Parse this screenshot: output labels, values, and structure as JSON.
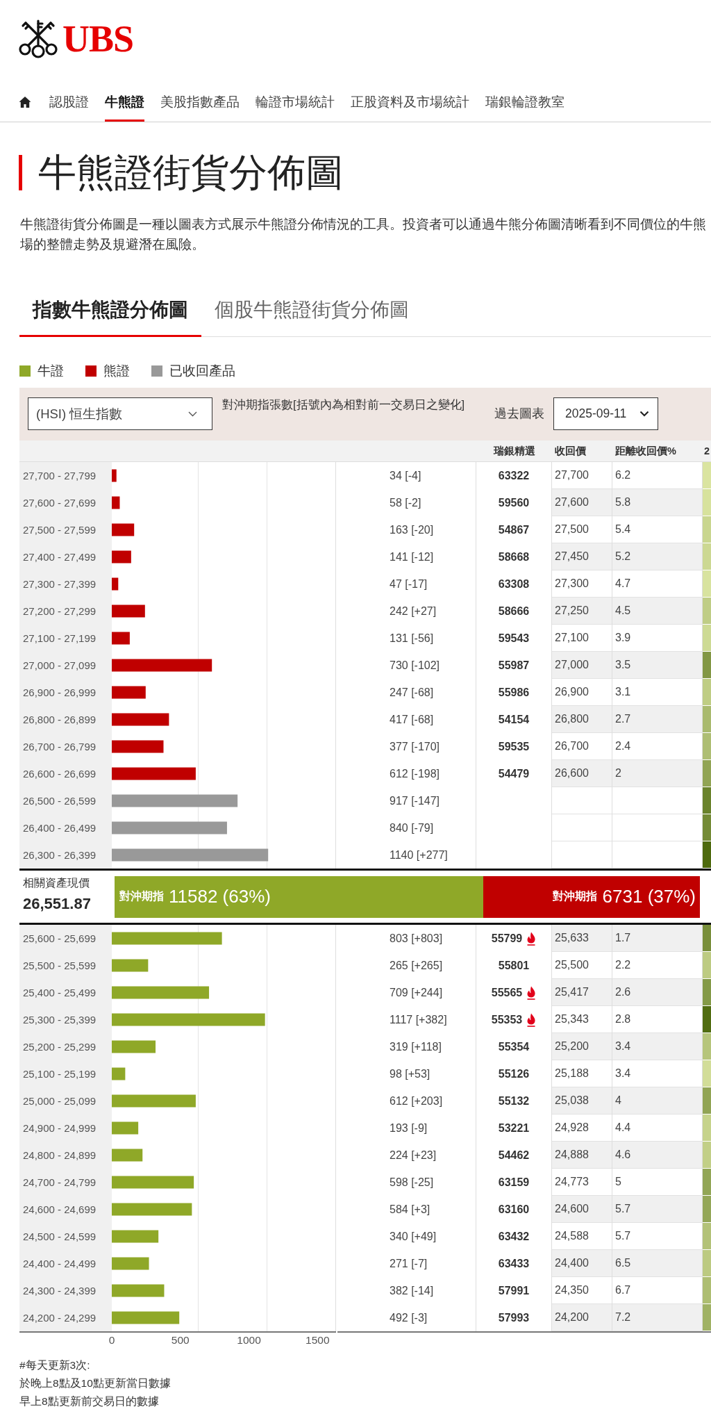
{
  "header": {
    "logo_text": "UBS"
  },
  "nav": [
    {
      "label": "認股證",
      "selected": false
    },
    {
      "label": "牛熊證",
      "selected": true
    },
    {
      "label": "美股指數產品",
      "selected": false
    },
    {
      "label": "輪證市場統計",
      "selected": false
    },
    {
      "label": "正股資料及市場統計",
      "selected": false
    },
    {
      "label": "瑞銀輪證教室",
      "selected": false
    }
  ],
  "page": {
    "title": "牛熊證街貨分佈圖",
    "description": "牛熊證街貨分佈圖是一種以圖表方式展示牛熊證分佈情況的工具。投資者可以通過牛熊分佈圖清晰看到不同價位的牛熊場的整體走勢及規避潛在風險。"
  },
  "tabs": [
    {
      "label": "指數牛熊證分佈圖",
      "selected": true
    },
    {
      "label": "個股牛熊證街貨分佈圖",
      "selected": false
    }
  ],
  "table": {
    "controls": {
      "index_select": "(HSI) 恒生指數",
      "caption": "對沖期指張數[括號內為相對前一交易日之變化]",
      "history_label": "過去圖表",
      "date_select": "2025-09-11"
    },
    "columns": [
      "瑞銀精選",
      "收回價",
      "距離收回價%",
      "2"
    ],
    "upper_section": {
      "chart_data": {
        "type": "bar",
        "orientation": "horizontal",
        "categories": [
          "27,700 - 27,799",
          "27,600 - 27,699",
          "27,500 - 27,599",
          "27,400 - 27,499",
          "27,300 - 27,399",
          "27,200 - 27,299",
          "27,100 - 27,199",
          "27,000 - 27,099",
          "26,900 - 26,999",
          "26,800 - 26,899",
          "26,700 - 26,799",
          "26,600 - 26,699",
          "26,500 - 26,599",
          "26,400 - 26,499",
          "26,300 - 26,399"
        ],
        "xlim": [
          0,
          1630
        ],
        "series": [
          {
            "name": "熊證",
            "color": "#c00000",
            "values": [
              34,
              58,
              163,
              141,
              47,
              242,
              131,
              730,
              247,
              417,
              377,
              612,
              null,
              null,
              null
            ]
          },
          {
            "name": "已收回產品",
            "color": "#999999",
            "values": [
              null,
              null,
              null,
              null,
              null,
              null,
              null,
              null,
              null,
              null,
              null,
              null,
              917,
              840,
              1140
            ]
          }
        ]
      },
      "rows": [
        {
          "count": "34 [-4]",
          "pick": "63322",
          "hot": false,
          "call_price": "27,700",
          "distance": "6.2",
          "column_7": {
            "color": "#dae4a0"
          }
        },
        {
          "count": "58 [-2]",
          "pick": "59560",
          "hot": false,
          "call_price": "27,600",
          "distance": "5.8",
          "column_7": {
            "color": "#d7e29d"
          }
        },
        {
          "count": "163 [-20]",
          "pick": "54867",
          "hot": false,
          "call_price": "27,500",
          "distance": "5.4",
          "column_7": {
            "color": "#c9d68f"
          }
        },
        {
          "count": "141 [-12]",
          "pick": "58668",
          "hot": false,
          "call_price": "27,450",
          "distance": "5.2",
          "column_7": {
            "color": "#ccd892"
          }
        },
        {
          "count": "47 [-17]",
          "pick": "63308",
          "hot": false,
          "call_price": "27,300",
          "distance": "4.7",
          "column_7": {
            "color": "#d8e39f"
          }
        },
        {
          "count": "242 [+27]",
          "pick": "58666",
          "hot": false,
          "call_price": "27,250",
          "distance": "4.5",
          "column_7": {
            "color": "#bfcd85"
          }
        },
        {
          "count": "131 [-56]",
          "pick": "59543",
          "hot": false,
          "call_price": "27,100",
          "distance": "3.9",
          "column_7": {
            "color": "#cdda94"
          }
        },
        {
          "count": "730 [-102]",
          "pick": "55987",
          "hot": false,
          "call_price": "27,000",
          "distance": "3.5",
          "column_7": {
            "color": "#829744"
          }
        },
        {
          "count": "247 [-68]",
          "pick": "55986",
          "hot": false,
          "call_price": "26,900",
          "distance": "3.1",
          "column_7": {
            "color": "#bfcd84"
          }
        },
        {
          "count": "417 [-68]",
          "pick": "54154",
          "hot": false,
          "call_price": "26,800",
          "distance": "2.7",
          "column_7": {
            "color": "#a9ba6e"
          }
        },
        {
          "count": "377 [-170]",
          "pick": "59535",
          "hot": false,
          "call_price": "26,700",
          "distance": "2.4",
          "column_7": {
            "color": "#aebe73"
          }
        },
        {
          "count": "612 [-198]",
          "pick": "54479",
          "hot": false,
          "call_price": "26,600",
          "distance": "2",
          "column_7": {
            "color": "#91a454"
          }
        },
        {
          "count": "917 [-147]",
          "hot": false,
          "column_7": {
            "color": "#6a832c"
          }
        },
        {
          "count": "840 [-79]",
          "hot": false,
          "column_7": {
            "color": "#748b36"
          }
        },
        {
          "count": "1140 [+277]",
          "hot": false,
          "column_7": {
            "color": "#4e6a0e"
          }
        }
      ]
    },
    "summary": {
      "label": "相關資產現價",
      "price": "26,551.87",
      "level": 0.63,
      "bull": {
        "label": "對沖期指",
        "value": "11582 (63%)"
      },
      "bear": {
        "label": "對沖期指",
        "value": "6731 (37%)"
      }
    },
    "lower_section": {
      "chart_data": {
        "type": "bar",
        "orientation": "horizontal",
        "categories": [
          "25,600 - 25,699",
          "25,500 - 25,599",
          "25,400 - 25,499",
          "25,300 - 25,399",
          "25,200 - 25,299",
          "25,100 - 25,199",
          "25,000 - 25,099",
          "24,900 - 24,999",
          "24,800 - 24,899",
          "24,700 - 24,799",
          "24,600 - 24,699",
          "24,500 - 24,599",
          "24,400 - 24,499",
          "24,300 - 24,399",
          "24,200 - 24,299"
        ],
        "xlim": [
          0,
          1630
        ],
        "xticks": [
          0,
          500,
          1000,
          1500
        ],
        "series": [
          {
            "name": "牛證",
            "color": "#8fa828",
            "values": [
              803,
              265,
              709,
              1117,
              319,
              98,
              612,
              193,
              224,
              598,
              584,
              340,
              271,
              382,
              492
            ]
          }
        ]
      },
      "rows": [
        {
          "count": "803 [+803]",
          "pick": "55799",
          "hot": true,
          "call_price": "25,633",
          "distance": "1.7",
          "column_7": {
            "color": "#798f3b"
          }
        },
        {
          "count": "265 [+265]",
          "pick": "55801",
          "hot": false,
          "call_price": "25,500",
          "distance": "2.2",
          "column_7": {
            "color": "#bdcb82"
          }
        },
        {
          "count": "709 [+244]",
          "pick": "55565",
          "hot": true,
          "call_price": "25,417",
          "distance": "2.6",
          "column_7": {
            "color": "#849a47"
          }
        },
        {
          "count": "1117 [+382]",
          "pick": "55353",
          "hot": true,
          "call_price": "25,343",
          "distance": "2.8",
          "column_7": {
            "color": "#516d11"
          }
        },
        {
          "count": "319 [+118]",
          "pick": "55354",
          "hot": false,
          "call_price": "25,200",
          "distance": "3.4",
          "column_7": {
            "color": "#b6c57b"
          }
        },
        {
          "count": "98 [+53]",
          "pick": "55126",
          "hot": false,
          "call_price": "25,188",
          "distance": "3.4",
          "column_7": {
            "color": "#d2dd98"
          }
        },
        {
          "count": "612 [+203]",
          "pick": "55132",
          "hot": false,
          "call_price": "25,038",
          "distance": "4",
          "column_7": {
            "color": "#91a454"
          }
        },
        {
          "count": "193 [-9]",
          "pick": "53221",
          "hot": false,
          "call_price": "24,928",
          "distance": "4.4",
          "column_7": {
            "color": "#c6d38b"
          }
        },
        {
          "count": "224 [+23]",
          "pick": "54462",
          "hot": false,
          "call_price": "24,888",
          "distance": "4.6",
          "column_7": {
            "color": "#c2cf87"
          }
        },
        {
          "count": "598 [-25]",
          "pick": "63159",
          "hot": false,
          "call_price": "24,773",
          "distance": "5",
          "column_7": {
            "color": "#92a656"
          }
        },
        {
          "count": "584 [+3]",
          "pick": "63160",
          "hot": false,
          "call_price": "24,600",
          "distance": "5.7",
          "column_7": {
            "color": "#94a758"
          }
        },
        {
          "count": "340 [+49]",
          "pick": "63432",
          "hot": false,
          "call_price": "24,588",
          "distance": "5.7",
          "column_7": {
            "color": "#b3c278"
          }
        },
        {
          "count": "271 [-7]",
          "pick": "63433",
          "hot": false,
          "call_price": "24,400",
          "distance": "6.5",
          "column_7": {
            "color": "#bcca81"
          }
        },
        {
          "count": "382 [-14]",
          "pick": "57991",
          "hot": false,
          "call_price": "24,350",
          "distance": "6.7",
          "column_7": {
            "color": "#aebe72"
          }
        },
        {
          "count": "492 [-3]",
          "pick": "57993",
          "hot": false,
          "call_price": "24,200",
          "distance": "7.2",
          "column_7": {
            "color": "#a0b264"
          }
        }
      ]
    }
  },
  "notes": [
    "#每天更新3次:",
    "於晚上8點及10點更新當日數據",
    "早上8點更新前交易日的數據"
  ]
}
